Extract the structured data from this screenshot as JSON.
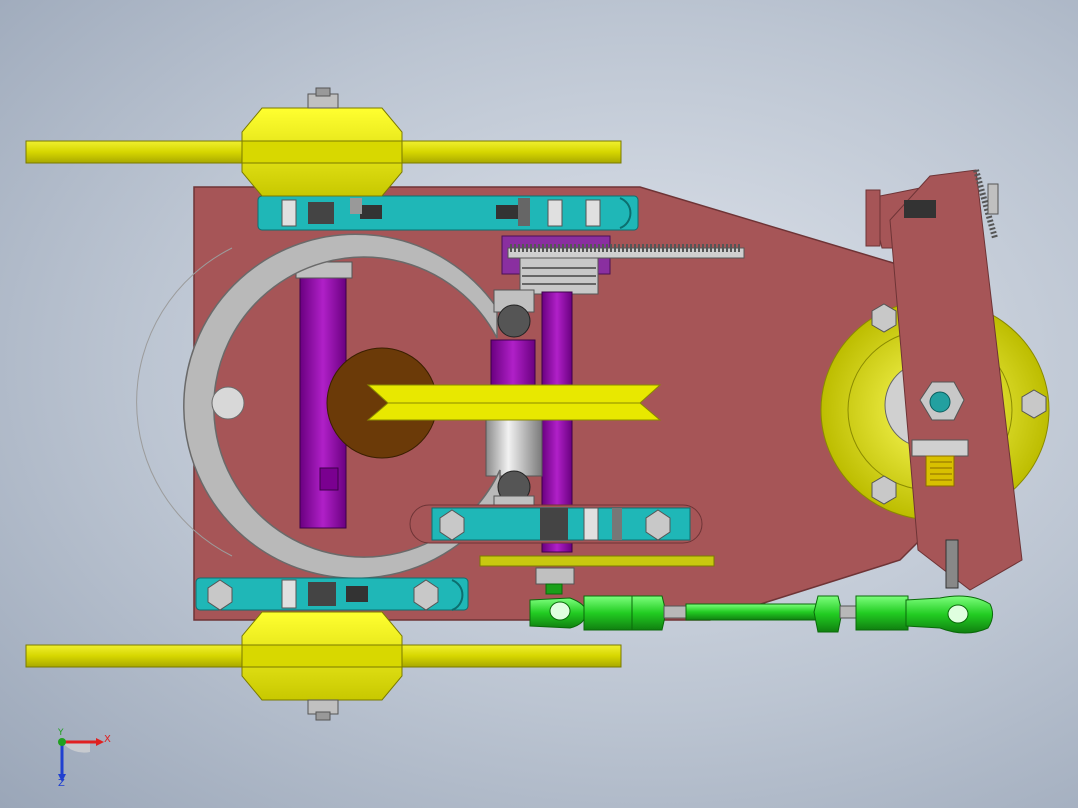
{
  "viewport": {
    "background_top": "#dfe4ec",
    "background_bottom": "#9aa6b8"
  },
  "model": {
    "colors": {
      "base_plate": "#a65557",
      "base_plate_edge": "#6e3436",
      "yellow_parts": "#e8e800",
      "rail": "#c8c810",
      "cyan_parts": "#1fb7b7",
      "purple_shaft": "#9010a8",
      "gray_ring": "#b9b9b9",
      "brown_disc": "#6b3a08",
      "green_rod": "#22cc22",
      "nut": "#b0b0b0"
    }
  },
  "triad": {
    "x_label": "X",
    "y_label": "Y",
    "z_label": "Z",
    "x_color": "#e02020",
    "y_color": "#20a020",
    "z_color": "#2040d0"
  }
}
